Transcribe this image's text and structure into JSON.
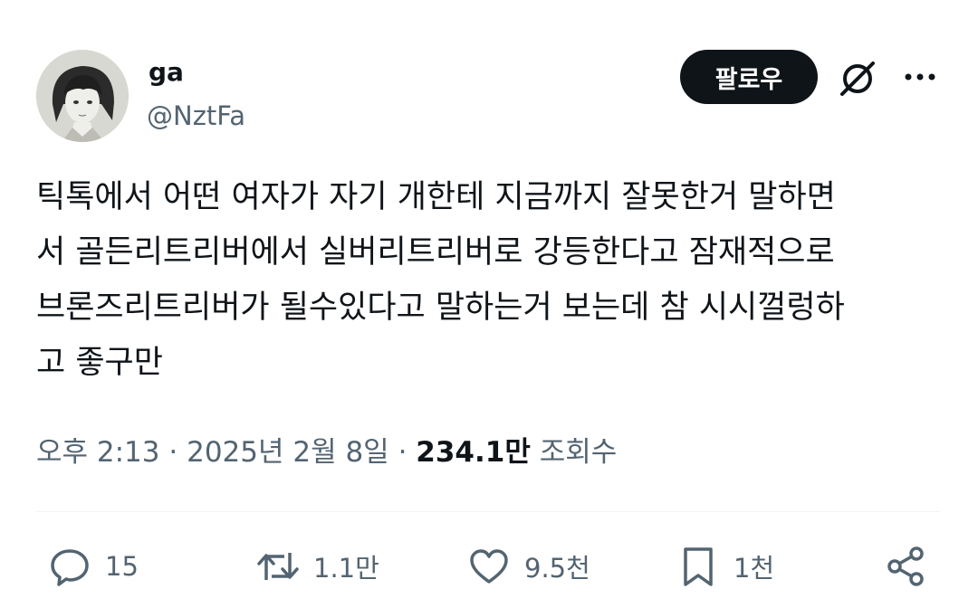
{
  "author": {
    "display_name": "ga",
    "handle": "@NztFa",
    "avatar_icon": "profile-photo-illustrated-girl"
  },
  "header": {
    "follow_label": "팔로우",
    "grok_icon": "grok-icon",
    "more_icon": "more-horizontal-icon"
  },
  "tweet": {
    "text": "틱톡에서 어떤 여자가 자기 개한테 지금까지 잘못한거 말하면\n서 골든리트리버에서 실버리트리버로 강등한다고 잠재적으로\n브론즈리트리버가 될수있다고 말하는거 보는데 참 시시껄렁하\n고 좋구만"
  },
  "meta": {
    "time": "오후 2:13",
    "separator": "·",
    "date": "2025년 2월 8일",
    "views_count": "234.1만",
    "views_label": "조회수"
  },
  "actions": {
    "reply": {
      "icon": "reply-icon",
      "count": "15"
    },
    "retweet": {
      "icon": "retweet-icon",
      "count": "1.1만"
    },
    "like": {
      "icon": "heart-icon",
      "count": "9.5천"
    },
    "bookmark": {
      "icon": "bookmark-icon",
      "count": "1천"
    },
    "share": {
      "icon": "share-icon"
    }
  },
  "colors": {
    "text_primary": "#0f1419",
    "text_secondary": "#536471",
    "follow_bg": "#0f1419",
    "divider": "#eff3f4"
  }
}
